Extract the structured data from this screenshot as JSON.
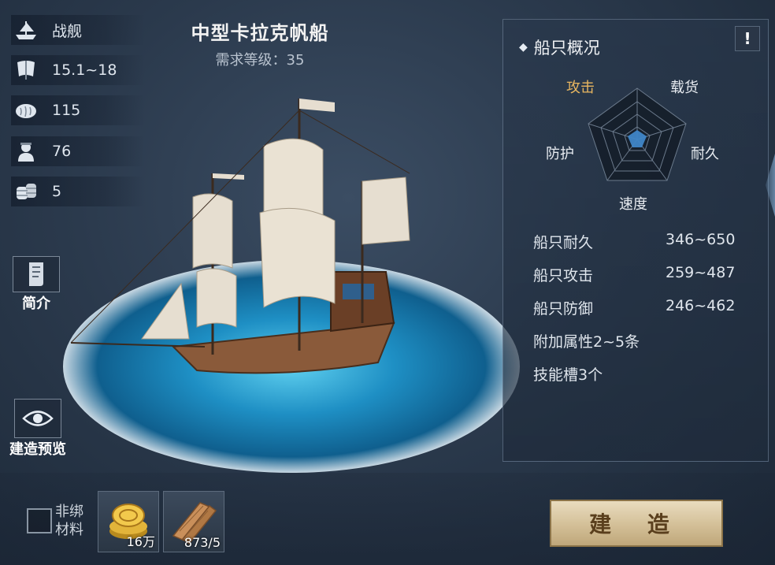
{
  "ship": {
    "name": "中型卡拉克帆船",
    "requirement": "需求等级：35"
  },
  "stats": [
    {
      "icon": "warship-icon",
      "value": "战舰"
    },
    {
      "icon": "sail-icon",
      "value": "15.1~18"
    },
    {
      "icon": "bread-icon",
      "value": "115"
    },
    {
      "icon": "sailor-icon",
      "value": "76"
    },
    {
      "icon": "barrel-icon",
      "value": "5"
    }
  ],
  "side_buttons": {
    "intro_label": "简介",
    "preview_label": "建造预览"
  },
  "panel": {
    "title": "船只概况",
    "info_symbol": "!",
    "radar": {
      "attack": "攻击",
      "cargo": "载货",
      "durability": "耐久",
      "speed": "速度",
      "defense": "防护"
    },
    "properties": [
      {
        "label": "船只耐久",
        "value": "346~650"
      },
      {
        "label": "船只攻击",
        "value": "259~487"
      },
      {
        "label": "船只防御",
        "value": "246~462"
      },
      {
        "label": "附加属性2~5条",
        "value": ""
      },
      {
        "label": "技能槽3个",
        "value": ""
      }
    ]
  },
  "materials": {
    "label_line1": "非绑",
    "label_line2": "材料",
    "items": [
      {
        "icon": "gold-coins-icon",
        "count": "16万"
      },
      {
        "icon": "wood-planks-icon",
        "count": "873/5"
      }
    ]
  },
  "build_button": "建 造",
  "colors": {
    "accent_attack": "#e8b660",
    "radar_fill": "#3f86c7",
    "sea": "#1e8fc4"
  }
}
